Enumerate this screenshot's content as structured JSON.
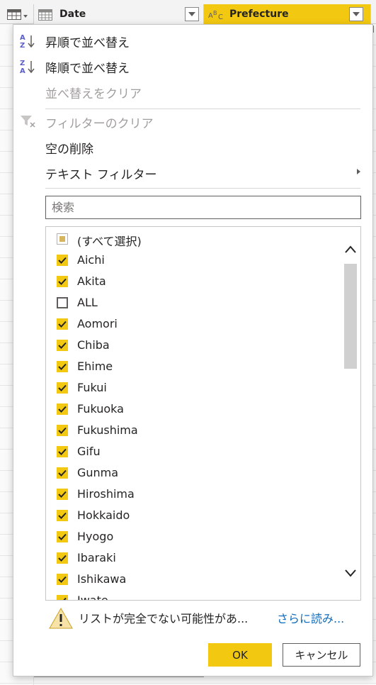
{
  "header": {
    "columns": [
      {
        "label": "Date",
        "type_icon": "calendar-table-icon"
      },
      {
        "label": "Prefecture",
        "type_icon": "abc-text-type-icon"
      }
    ]
  },
  "menu": {
    "sort_ascending": "昇順で並べ替え",
    "sort_descending": "降順で並べ替え",
    "clear_sort": "並べ替えをクリア",
    "clear_filter": "フィルターのクリア",
    "remove_empty": "空の削除",
    "text_filters": "テキスト フィルター"
  },
  "search": {
    "placeholder": "検索",
    "value": ""
  },
  "list": {
    "items": [
      {
        "label": "(すべて選択)",
        "state": "partial"
      },
      {
        "label": "Aichi",
        "state": "checked"
      },
      {
        "label": "Akita",
        "state": "checked"
      },
      {
        "label": "ALL",
        "state": "unchecked"
      },
      {
        "label": "Aomori",
        "state": "checked"
      },
      {
        "label": "Chiba",
        "state": "checked"
      },
      {
        "label": "Ehime",
        "state": "checked"
      },
      {
        "label": "Fukui",
        "state": "checked"
      },
      {
        "label": "Fukuoka",
        "state": "checked"
      },
      {
        "label": "Fukushima",
        "state": "checked"
      },
      {
        "label": "Gifu",
        "state": "checked"
      },
      {
        "label": "Gunma",
        "state": "checked"
      },
      {
        "label": "Hiroshima",
        "state": "checked"
      },
      {
        "label": "Hokkaido",
        "state": "checked"
      },
      {
        "label": "Hyogo",
        "state": "checked"
      },
      {
        "label": "Ibaraki",
        "state": "checked"
      },
      {
        "label": "Ishikawa",
        "state": "checked"
      },
      {
        "label": "Iwate",
        "state": "checked"
      }
    ]
  },
  "footer": {
    "warning": "リストが完全でない可能性があ...",
    "load_more": "さらに読み...",
    "ok": "OK",
    "cancel": "キャンセル"
  },
  "colors": {
    "accent": "#f2c811",
    "link": "#0f6cbd"
  }
}
